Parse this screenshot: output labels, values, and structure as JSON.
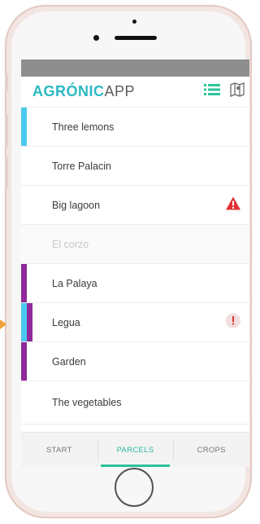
{
  "app": {
    "logo_part1": "AGRÓNIC",
    "logo_part2": "APP",
    "accent": "#2bb8c3"
  },
  "header_icons": {
    "list": "list-icon",
    "map": "map-icon",
    "list_color": "#2bc39a",
    "map_color": "#6a6a6a"
  },
  "parcels": [
    {
      "label": "Three lemons",
      "stripe": "#4cc9f0",
      "alert": null,
      "muted": false
    },
    {
      "label": "Torre Palacin",
      "stripe": null,
      "alert": null,
      "muted": false
    },
    {
      "label": "Big lagoon",
      "stripe": null,
      "alert": "warning-triangle",
      "alert_color": "#e03131",
      "muted": false
    },
    {
      "label": "El corzo",
      "stripe": null,
      "alert": null,
      "muted": true
    },
    {
      "label": "La Palaya",
      "stripe": "#8e2a9a",
      "alert": null,
      "muted": false
    },
    {
      "label": "Legua",
      "stripe": [
        "#4cc9f0",
        "#8e2a9a"
      ],
      "alert": "exclamation-circle",
      "alert_color": "#e03131",
      "muted": false
    },
    {
      "label": "Garden",
      "stripe": "#8e2a9a",
      "alert": null,
      "muted": false
    },
    {
      "label": "The vegetables",
      "stripe": null,
      "alert": null,
      "muted": false
    }
  ],
  "tabs": [
    {
      "label": "START",
      "active": false
    },
    {
      "label": "PARCELS",
      "active": true
    },
    {
      "label": "CROPS",
      "active": false
    }
  ]
}
